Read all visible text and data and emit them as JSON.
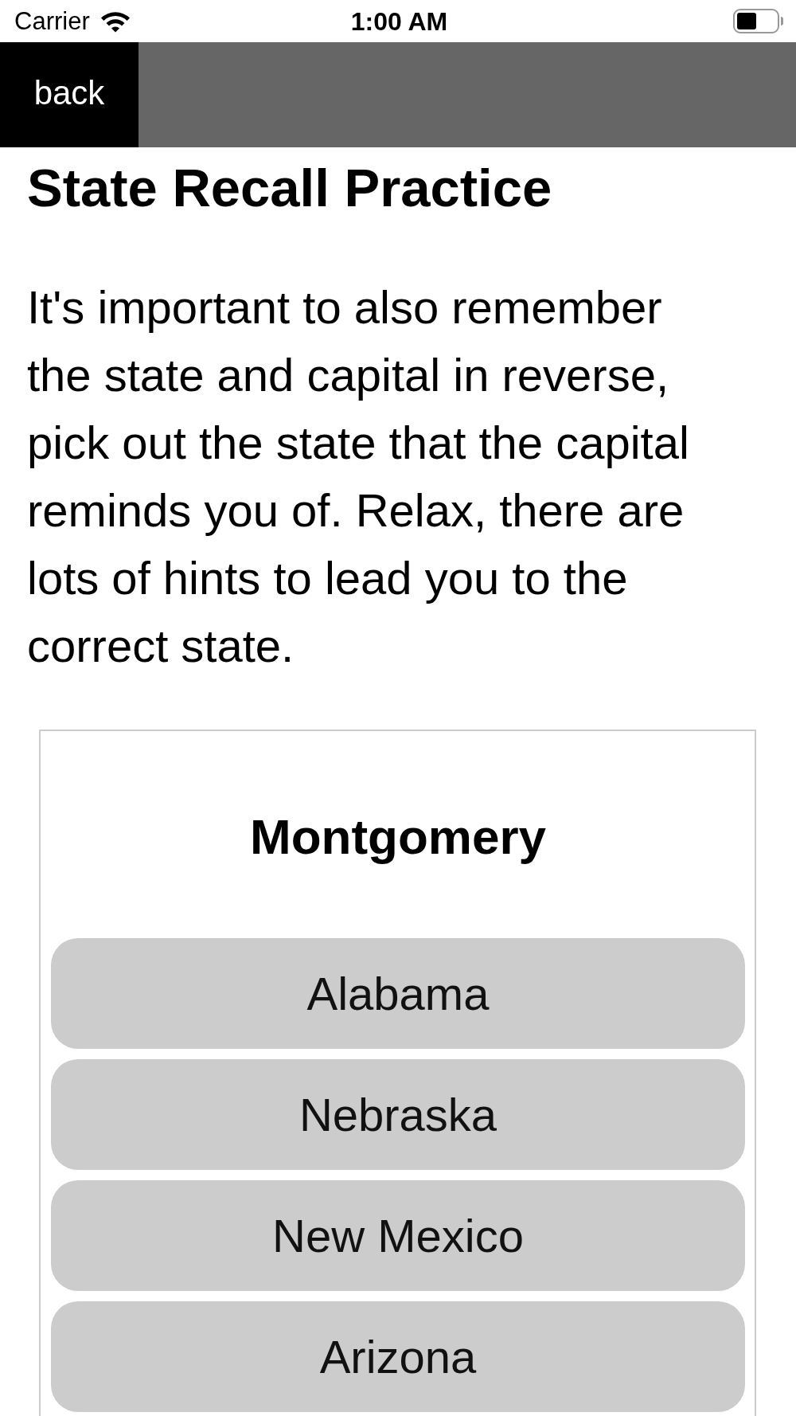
{
  "status_bar": {
    "carrier": "Carrier",
    "time": "1:00 AM"
  },
  "nav_bar": {
    "back_button": "back"
  },
  "title": "State Recall Practice",
  "description": "It's important to also remember the state and capital in reverse, pick out the state that the capital reminds you of. Relax, there are lots of hints to lead you to the correct state.",
  "quiz_card": {
    "prompt": "Montgomery",
    "options": [
      {
        "label": "Alabama"
      },
      {
        "label": "Nebraska"
      },
      {
        "label": "New Mexico"
      },
      {
        "label": "Arizona"
      }
    ]
  }
}
